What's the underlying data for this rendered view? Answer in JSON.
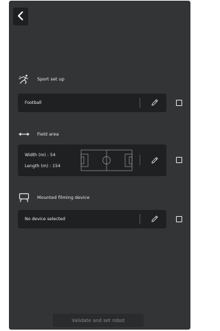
{
  "header": {
    "back_icon": "chevron-left-icon"
  },
  "sport": {
    "title": "Sport set up",
    "icon": "running-person-icon",
    "value": "Football",
    "edit_icon": "pencil-icon",
    "checked": false
  },
  "field": {
    "title": "Field area",
    "icon": "double-arrow-icon",
    "width_text": "Width (m) : 54",
    "length_text": "Length (m) : 154",
    "pitch_icon": "football-pitch-icon",
    "edit_icon": "pencil-icon",
    "checked": false
  },
  "device": {
    "title": "Mounted filming device",
    "icon": "monitor-mount-icon",
    "value": "No device selected",
    "edit_icon": "pencil-icon",
    "checked": false
  },
  "footer": {
    "validate_label": "Validate and set robot"
  },
  "colors": {
    "background": "#333436",
    "card": "#1f2022",
    "text": "#e6e6e6",
    "button_text": "#8a8b8e"
  }
}
